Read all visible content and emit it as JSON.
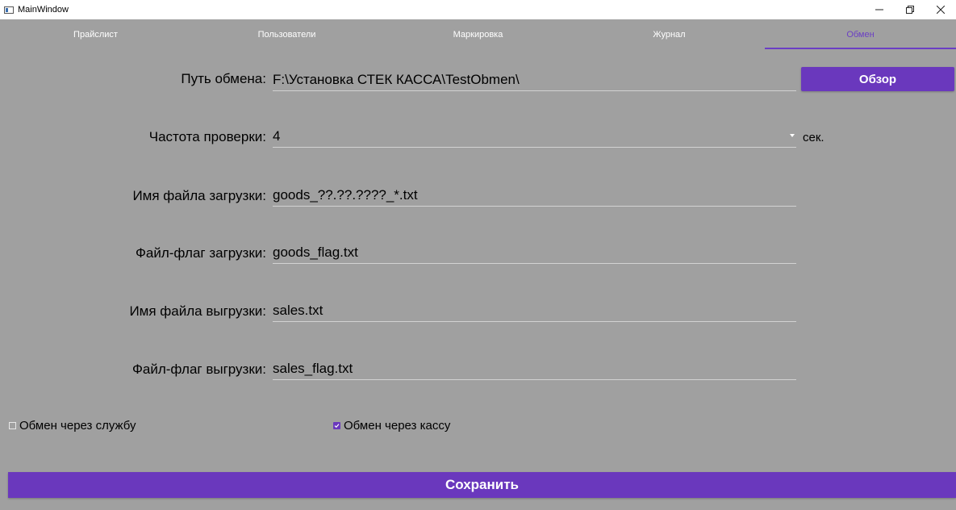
{
  "window": {
    "title": "MainWindow",
    "controls": [
      "minimize-icon",
      "restore-icon",
      "close-icon"
    ]
  },
  "tabs": [
    {
      "label": "Прайслист",
      "active": false
    },
    {
      "label": "Пользователи",
      "active": false
    },
    {
      "label": "Маркировка",
      "active": false
    },
    {
      "label": "Журнал",
      "active": false
    },
    {
      "label": "Обмен",
      "active": true
    }
  ],
  "form": {
    "exchange_path": {
      "label": "Путь обмена:",
      "value": "F:\\Установка СТЕК КАССА\\TestObmen\\"
    },
    "browse_label": "Обзор",
    "check_frequency": {
      "label": "Частота проверки:",
      "value": "4",
      "unit": "сек."
    },
    "upload_file_name": {
      "label": "Имя файла загрузки:",
      "value": "goods_??.??.????_*.txt"
    },
    "upload_flag_file": {
      "label": "Файл-флаг загрузки:",
      "value": "goods_flag.txt"
    },
    "download_file_name": {
      "label": "Имя файла выгрузки:",
      "value": "sales.txt"
    },
    "download_flag_file": {
      "label": "Файл-флаг выгрузки:",
      "value": "sales_flag.txt"
    }
  },
  "options": {
    "via_service": {
      "label": "Обмен через службу",
      "checked": false
    },
    "via_cashbox": {
      "label": "Обмен через кассу",
      "checked": true
    }
  },
  "save_label": "Сохранить",
  "colors": {
    "background": "#a0a0a0",
    "accent": "#6a38bd",
    "tab_text": "#ffffff"
  }
}
